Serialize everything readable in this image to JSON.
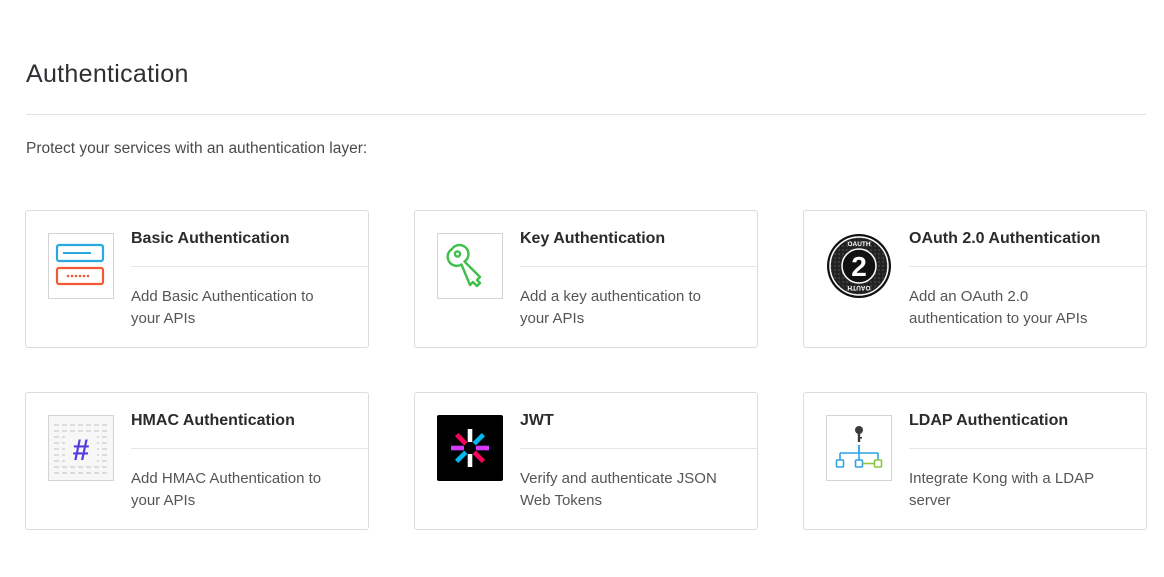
{
  "page": {
    "title": "Authentication",
    "intro": "Protect your services with an authentication layer:"
  },
  "plugins": [
    {
      "title": "Basic Authentication",
      "description": "Add Basic Authentication to your APIs",
      "icon": "basic-auth-icon"
    },
    {
      "title": "Key Authentication",
      "description": "Add a key authentication to your APIs",
      "icon": "key-icon"
    },
    {
      "title": "OAuth 2.0 Authentication",
      "description": "Add an OAuth 2.0 authentication to your APIs",
      "icon": "oauth2-icon",
      "icon_text": "OAUTH",
      "icon_number": "2"
    },
    {
      "title": "HMAC Authentication",
      "description": "Add HMAC Authentication to your APIs",
      "icon": "hmac-icon",
      "icon_text": "#"
    },
    {
      "title": "JWT",
      "description": "Verify and authenticate JSON Web Tokens",
      "icon": "jwt-icon"
    },
    {
      "title": "LDAP Authentication",
      "description": "Integrate Kong with a LDAP server",
      "icon": "ldap-icon"
    }
  ],
  "colors": {
    "basic_blue": "#29a9e0",
    "basic_orange": "#f05a36",
    "key_green": "#3fbf4a",
    "hmac_purple": "#5a3cdc",
    "ldap_blue": "#2ea4e4",
    "ldap_green": "#8cc63f"
  }
}
